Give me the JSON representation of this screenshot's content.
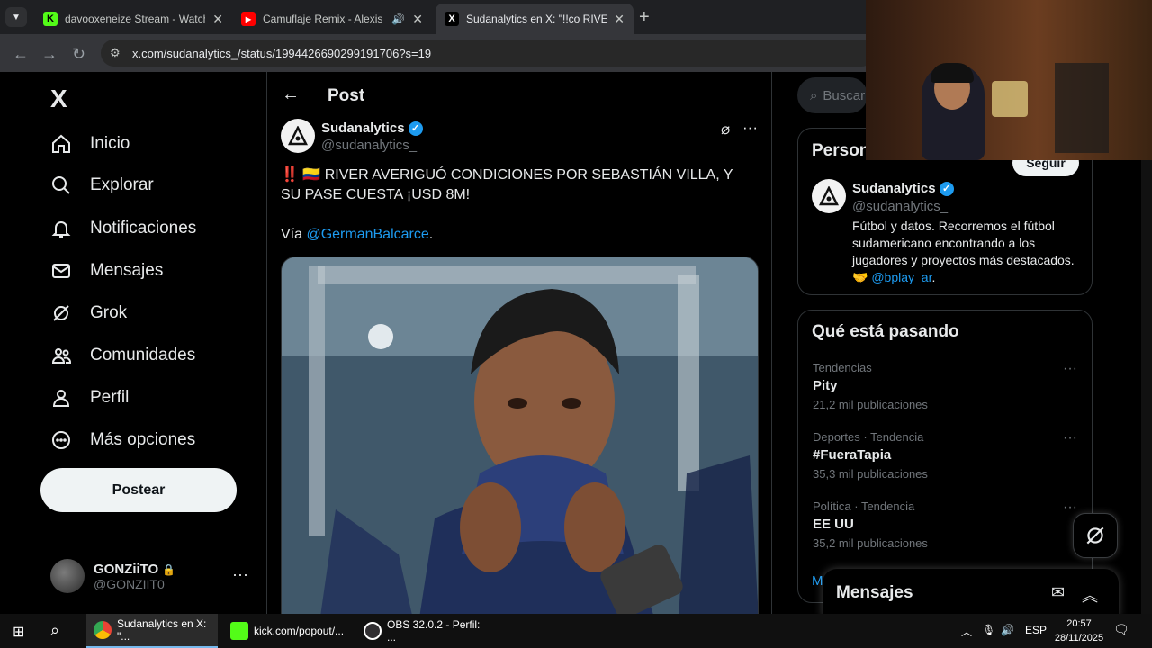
{
  "browser": {
    "tabs": [
      {
        "title": "davooxeneize Stream - Watch L",
        "favicon": "K",
        "color": "#53fc18"
      },
      {
        "title": "Camuflaje Remix - Alexis y F",
        "favicon": "▶",
        "color": "#ff0000"
      },
      {
        "title": "Sudanalytics en X: \"!!co RIVER A",
        "favicon": "X",
        "color": "#000000"
      }
    ],
    "url": "x.com/sudanalytics_/status/1994426690299191706?s=19"
  },
  "sidebar": {
    "logo": "X",
    "items": [
      {
        "label": "Inicio",
        "icon": "home-icon"
      },
      {
        "label": "Explorar",
        "icon": "search-icon"
      },
      {
        "label": "Notificaciones",
        "icon": "bell-icon"
      },
      {
        "label": "Mensajes",
        "icon": "mail-icon"
      },
      {
        "label": "Grok",
        "icon": "grok-icon"
      },
      {
        "label": "Comunidades",
        "icon": "people-icon"
      },
      {
        "label": "Perfil",
        "icon": "person-icon"
      },
      {
        "label": "Más opciones",
        "icon": "more-circle-icon"
      }
    ],
    "post_button": "Postear",
    "account": {
      "name": "GONZiiTO",
      "handle": "@GONZIIT0"
    }
  },
  "post": {
    "header": "Post",
    "author_name": "Sudanalytics",
    "author_handle": "@sudanalytics_",
    "text_prefix": "‼️ 🇨🇴",
    "text": "RIVER AVERIGUÓ CONDICIONES POR SEBASTIÁN VILLA, Y SU PASE CUESTA ¡USD 8M!",
    "via_label": "Vía",
    "via_mention": "@GermanBalcarce",
    "via_suffix": "."
  },
  "right": {
    "search_placeholder": "Buscar",
    "persons_title": "Person",
    "profile": {
      "name": "Sudanalytics",
      "handle": "@sudanalytics_",
      "bio": "Fútbol y datos. Recorremos el fútbol sudamericano encontrando a los jugadores y proyectos más destacados. 🤝",
      "bio_link": "@bplay_ar",
      "bio_end": ".",
      "follow": "Seguir"
    },
    "trends_title": "Qué está pasando",
    "trends": [
      {
        "category": "Tendencias",
        "name": "Pity",
        "count": "21,2 mil publicaciones"
      },
      {
        "category": "Deportes · Tendencia",
        "name": "#FueraTapia",
        "count": "35,3 mil publicaciones"
      },
      {
        "category": "Política · Tendencia",
        "name": "EE UU",
        "count": "35,2 mil publicaciones"
      }
    ],
    "more_letter": "M",
    "messages_drawer": "Mensajes"
  },
  "taskbar": {
    "apps": [
      {
        "label": "Sudanalytics en X: \"...",
        "color": "#4285f4"
      },
      {
        "label": "kick.com/popout/...",
        "color": "#53fc18"
      },
      {
        "label": "OBS 32.0.2 - Perfil: ...",
        "color": "#302e31"
      }
    ],
    "lang": "ESP",
    "time": "20:57",
    "date": "28/11/2025"
  }
}
